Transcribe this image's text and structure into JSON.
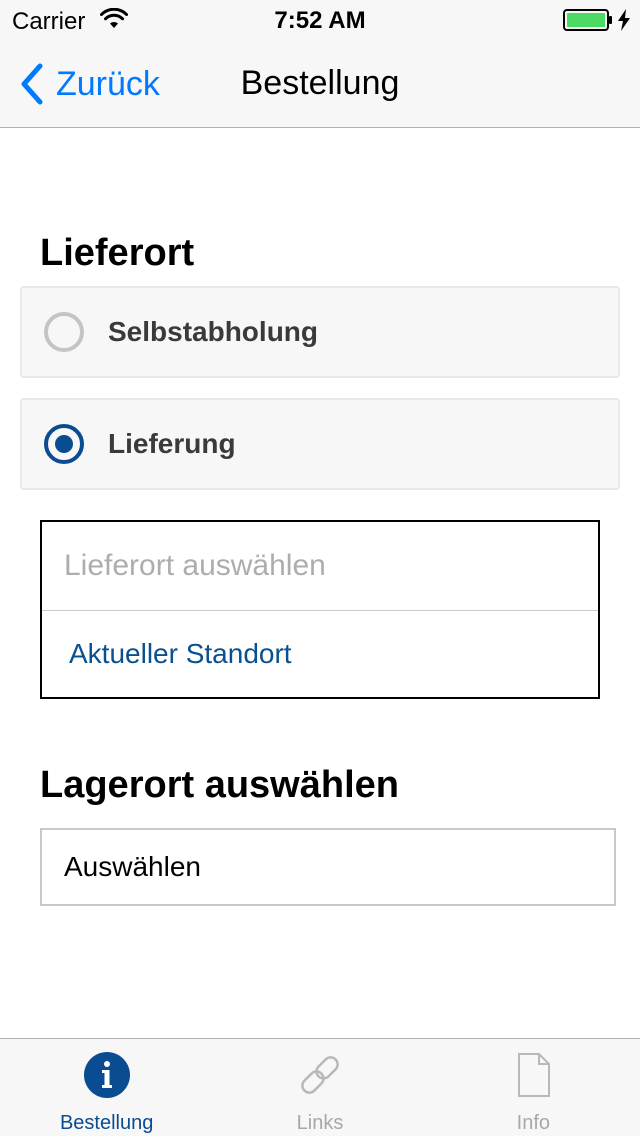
{
  "status_bar": {
    "carrier": "Carrier",
    "time": "7:52 AM",
    "icons": [
      "wifi-icon",
      "battery-icon",
      "charging-bolt-icon"
    ],
    "battery_color": "#4cd964"
  },
  "nav": {
    "back_label": "Zurück",
    "title": "Bestellung",
    "accent_color": "#007aff"
  },
  "lieferort": {
    "title": "Lieferort",
    "options": [
      {
        "label": "Selbstabholung",
        "selected": false
      },
      {
        "label": "Lieferung",
        "selected": true
      }
    ],
    "location_placeholder": "Lieferort auswählen",
    "location_value": "",
    "current_location_label": "Aktueller Standort"
  },
  "lagerort": {
    "title": "Lagerort auswählen",
    "select_value": "Auswählen"
  },
  "tab_bar": {
    "tabs": [
      {
        "label": "Bestellung",
        "icon": "info-circle-icon",
        "active": true
      },
      {
        "label": "Links",
        "icon": "link-icon",
        "active": false
      },
      {
        "label": "Info",
        "icon": "document-icon",
        "active": false
      }
    ],
    "active_color": "#0a4c92",
    "inactive_color": "#a8a8a8"
  }
}
